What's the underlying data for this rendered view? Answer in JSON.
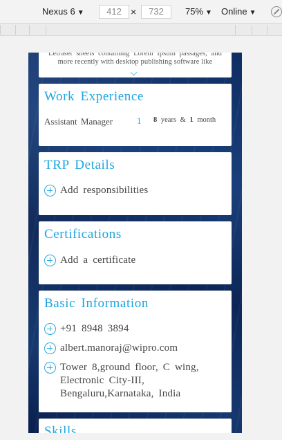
{
  "toolbar": {
    "device": "Nexus 6",
    "width": "412",
    "height": "732",
    "times": "×",
    "zoom": "75%",
    "network": "Online",
    "dropdown_arrow": "▼"
  },
  "about": {
    "text": "Letraset sheets containing Lorem Ipsum passages, and more recently with desktop publishing software like"
  },
  "work_experience": {
    "title": "Work Experience",
    "role": "Assistant Manager",
    "count": "1",
    "years_num": "8",
    "years_label": "years",
    "amp": "&",
    "months_num": "1",
    "months_label": "month"
  },
  "trp": {
    "title": "TRP Details",
    "add_label": "Add responsibilities"
  },
  "certifications": {
    "title": "Certifications",
    "add_label": "Add a certificate"
  },
  "basic_info": {
    "title": "Basic Information",
    "phone": "+91 8948 3894",
    "email": "albert.manoraj@wipro.com",
    "address": "Tower 8,ground floor, C wing, Electronic City-III, Bengaluru,Karnataka, India"
  },
  "skills": {
    "title": "Skills"
  },
  "colors": {
    "accent": "#1ba5df",
    "background_top": "#0e2e63",
    "card": "#ffffff"
  }
}
